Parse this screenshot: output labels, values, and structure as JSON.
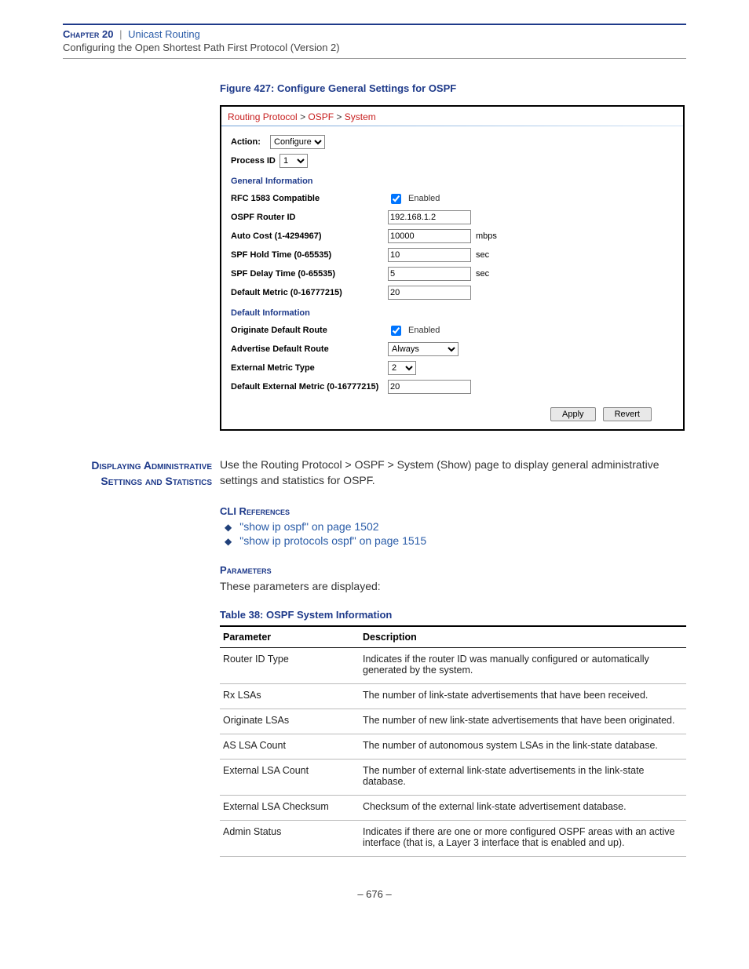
{
  "header": {
    "chapter": "Chapter 20",
    "title": "Unicast Routing",
    "subtitle": "Configuring the Open Shortest Path First Protocol (Version 2)"
  },
  "figure": {
    "caption": "Figure 427:  Configure General Settings for OSPF"
  },
  "screenshot": {
    "breadcrumb": {
      "a": "Routing Protocol",
      "b": "OSPF",
      "c": "System"
    },
    "action_label": "Action:",
    "action_value": "Configure",
    "process_id_label": "Process ID",
    "process_id_value": "1",
    "section_general": "General Information",
    "rfc_label": "RFC 1583 Compatible",
    "enabled_label": "Enabled",
    "router_id_label": "OSPF Router ID",
    "router_id_value": "192.168.1.2",
    "auto_cost_label": "Auto Cost (1-4294967)",
    "auto_cost_value": "10000",
    "auto_cost_unit": "mbps",
    "hold_label": "SPF Hold Time (0-65535)",
    "hold_value": "10",
    "hold_unit": "sec",
    "delay_label": "SPF Delay Time (0-65535)",
    "delay_value": "5",
    "delay_unit": "sec",
    "def_metric_label": "Default Metric (0-16777215)",
    "def_metric_value": "20",
    "section_default": "Default Information",
    "orig_label": "Originate Default Route",
    "adv_label": "Advertise Default Route",
    "adv_value": "Always",
    "ext_type_label": "External Metric Type",
    "ext_type_value": "2",
    "def_ext_label": "Default External Metric (0-16777215)",
    "def_ext_value": "20",
    "apply_btn": "Apply",
    "revert_btn": "Revert"
  },
  "section_heading": "Displaying Administrative Settings and Statistics",
  "intro": "Use the Routing Protocol > OSPF > System (Show) page to display general administrative settings and statistics for OSPF.",
  "cli_heading": "CLI References",
  "cli_refs": [
    "\"show ip ospf\" on page 1502",
    "\"show ip protocols ospf\" on page 1515"
  ],
  "param_heading": "Parameters",
  "param_intro": "These parameters are displayed:",
  "table_caption": "Table 38: OSPF System Information",
  "table": {
    "head_param": "Parameter",
    "head_desc": "Description",
    "rows": [
      {
        "p": "Router ID Type",
        "d": "Indicates if the router ID was manually configured or automatically generated by the system."
      },
      {
        "p": "Rx LSAs",
        "d": "The number of link-state advertisements that have been received."
      },
      {
        "p": "Originate LSAs",
        "d": "The number of new link-state advertisements that have been originated."
      },
      {
        "p": "AS LSA Count",
        "d": "The number of autonomous system LSAs in the link-state database."
      },
      {
        "p": "External LSA Count",
        "d": "The number of external link-state advertisements in the link-state database."
      },
      {
        "p": "External LSA Checksum",
        "d": "Checksum of the external link-state advertisement database."
      },
      {
        "p": "Admin Status",
        "d": "Indicates if there are one or more configured OSPF areas with an active interface (that is, a Layer 3 interface that is enabled and up)."
      }
    ]
  },
  "page_number": "–  676  –"
}
